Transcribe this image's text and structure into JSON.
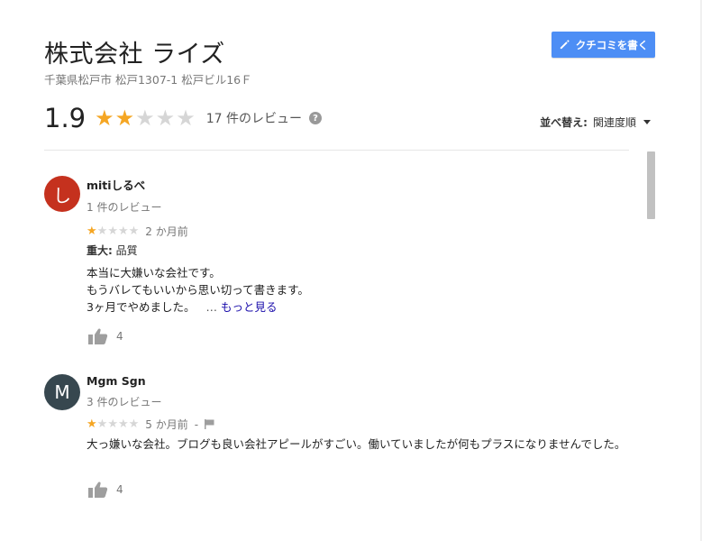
{
  "business": {
    "name": "株式会社 ライズ",
    "address": "千葉県松戸市 松戸1307-1 松戸ビル16Ｆ"
  },
  "write_button": {
    "label": "クチコミを書く",
    "icon": "pencil-icon"
  },
  "summary": {
    "rating": "1.9",
    "rating_value": 1.9,
    "stars_filled": 2,
    "stars_total": 5,
    "review_count": "17 件のレビュー",
    "help": "?"
  },
  "sort": {
    "label": "並べ替え:",
    "value": "関連度順"
  },
  "colors": {
    "star": "#f5a623",
    "star_empty": "#d6d6d6",
    "accent": "#4d8ef5",
    "link": "#1a0dab"
  },
  "reviews": [
    {
      "avatar_letter": "し",
      "avatar_color": "#c5311e",
      "name": "mitiしるべ",
      "meta": "1 件のレビュー",
      "stars": 1,
      "date": "2 か月前",
      "aspect_label": "重大:",
      "aspect_value": "品質",
      "lines": [
        "本当に大嫌いな会社です。",
        "もうバレてもいいから思い切って書きます。",
        "3ヶ月でやめました。"
      ],
      "ellipsis": "…",
      "more": "もっと見る",
      "likes": "4"
    },
    {
      "avatar_letter": "M",
      "avatar_color": "#37474f",
      "name": "Mgm Sgn",
      "meta": "3 件のレビュー",
      "stars": 1,
      "date": "5 か月前",
      "date_sep": "-",
      "text": "大っ嫌いな会社。ブログも良い会社アピールがすごい。働いていましたが何もプラスになりませんでした。",
      "likes": "4"
    }
  ]
}
